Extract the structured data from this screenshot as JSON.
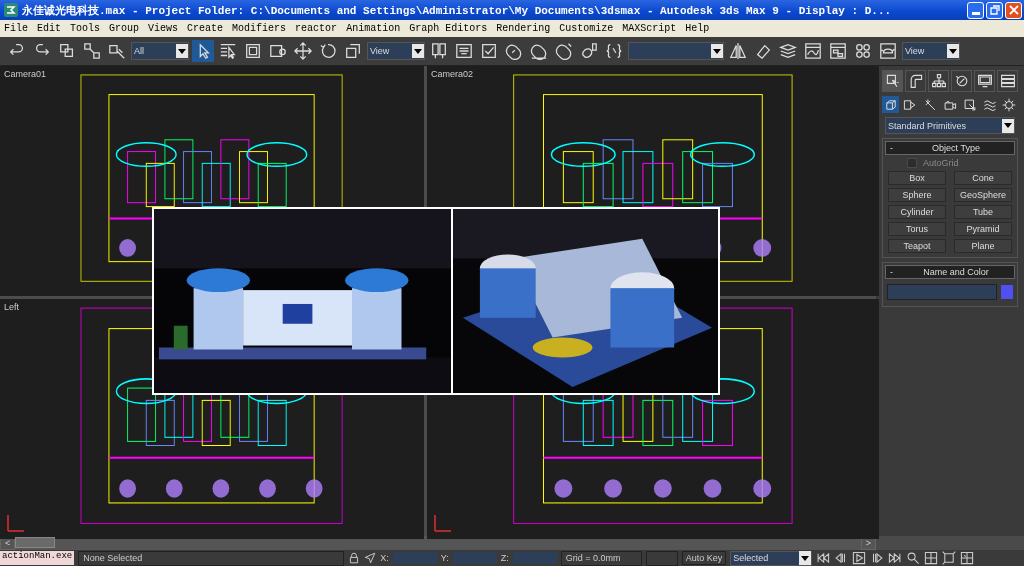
{
  "window": {
    "title": "永佳诚光电科技.max   - Project Folder: C:\\Documents and Settings\\Administrator\\My Documents\\3dsmax   - Autodesk 3ds Max 9   - Display : D..."
  },
  "menu": [
    "File",
    "Edit",
    "Tools",
    "Group",
    "Views",
    "Create",
    "Modifiers",
    "reactor",
    "Animation",
    "Graph Editors",
    "Rendering",
    "Customize",
    "MAXScript",
    "Help"
  ],
  "toolbar": [
    {
      "kind": "button",
      "selected": false
    },
    {
      "kind": "button",
      "selected": false
    },
    {
      "kind": "button",
      "selected": false
    },
    {
      "kind": "button",
      "selected": false
    },
    {
      "kind": "button",
      "selected": false
    },
    {
      "kind": "dropdown",
      "value": "All"
    },
    {
      "kind": "button",
      "selected": true
    },
    {
      "kind": "button",
      "selected": false
    },
    {
      "kind": "button",
      "selected": false
    },
    {
      "kind": "button",
      "selected": false
    },
    {
      "kind": "button",
      "selected": false
    },
    {
      "kind": "button",
      "selected": false
    },
    {
      "kind": "button",
      "selected": false
    },
    {
      "kind": "dropdown",
      "value": "View"
    },
    {
      "kind": "button",
      "selected": false
    },
    {
      "kind": "button",
      "selected": false
    },
    {
      "kind": "button",
      "selected": false
    },
    {
      "kind": "button",
      "selected": false
    },
    {
      "kind": "button",
      "selected": false
    },
    {
      "kind": "button",
      "selected": false
    },
    {
      "kind": "button",
      "selected": false
    },
    {
      "kind": "button",
      "selected": false
    },
    {
      "kind": "dropdown"
    },
    {
      "kind": "button",
      "selected": false
    },
    {
      "kind": "button",
      "selected": false
    },
    {
      "kind": "button",
      "selected": false
    },
    {
      "kind": "button",
      "selected": false
    },
    {
      "kind": "button",
      "selected": false
    },
    {
      "kind": "button",
      "selected": false
    },
    {
      "kind": "button",
      "selected": false
    },
    {
      "kind": "dropdown",
      "value": "View"
    }
  ],
  "viewports": [
    {
      "label": "Camera01"
    },
    {
      "label": "Camera02"
    },
    {
      "label": "Left"
    }
  ],
  "command_panel": {
    "tabs": [
      {
        "selected": true
      },
      {
        "selected": false
      },
      {
        "selected": false
      },
      {
        "selected": false
      },
      {
        "selected": false
      },
      {
        "selected": false
      }
    ],
    "subtabs": [
      {
        "selected": true
      },
      {
        "selected": false
      },
      {
        "selected": false
      },
      {
        "selected": false
      },
      {
        "selected": false
      },
      {
        "selected": false
      },
      {
        "selected": false
      }
    ],
    "category": "Standard Primitives",
    "rollouts": [
      {
        "sign": "-",
        "title": "Object Type",
        "autogrid": {
          "label": "AutoGrid",
          "checked": false,
          "disabled": true
        },
        "buttons": [
          "Box",
          "Cone",
          "Sphere",
          "GeoSphere",
          "Cylinder",
          "Tube",
          "Torus",
          "Pyramid",
          "Teapot",
          "Plane"
        ]
      },
      {
        "sign": "-",
        "title": "Name and Color",
        "color": "#5050f0"
      }
    ]
  },
  "time_slider": {
    "prev": "<",
    "next": ">",
    "level": 0
  },
  "status_bar": {
    "listener": "actionMan.exe",
    "selection": "None Selected",
    "coords": [
      "X:",
      "Y:",
      "Z:"
    ],
    "grid": "Grid = 0.0mm",
    "auto_key": "Auto Key",
    "key_filter": "Selected"
  }
}
